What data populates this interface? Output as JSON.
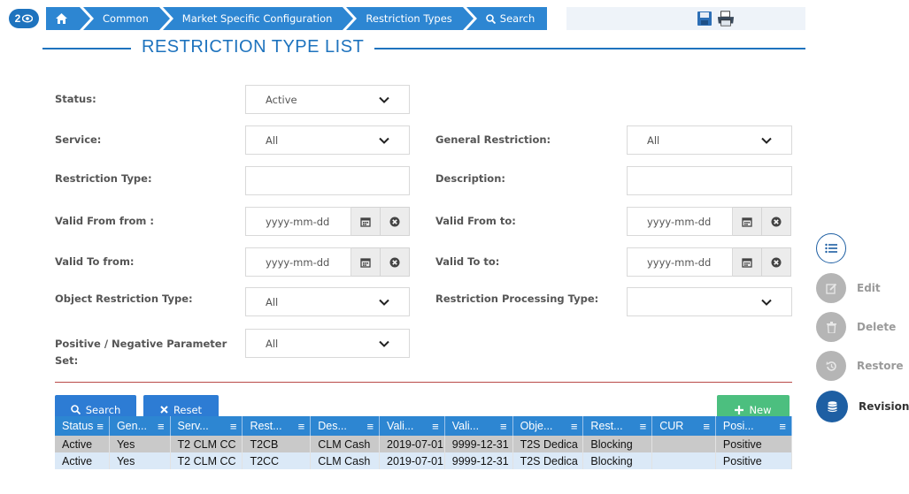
{
  "breadcrumb": {
    "badge": "2",
    "items": [
      "Common",
      "Market Specific Configuration",
      "Restriction Types",
      "Search"
    ]
  },
  "title": "RESTRICTION TYPE LIST",
  "form": {
    "status": {
      "label": "Status:",
      "value": "Active"
    },
    "service": {
      "label": "Service:",
      "value": "All"
    },
    "general_restriction": {
      "label": "General Restriction:",
      "value": "All"
    },
    "restriction_type": {
      "label": "Restriction Type:",
      "value": ""
    },
    "description": {
      "label": "Description:",
      "value": ""
    },
    "valid_from_from": {
      "label": "Valid From from :",
      "placeholder": "yyyy-mm-dd"
    },
    "valid_from_to": {
      "label": "Valid From to:",
      "placeholder": "yyyy-mm-dd"
    },
    "valid_to_from": {
      "label": "Valid To from:",
      "placeholder": "yyyy-mm-dd"
    },
    "valid_to_to": {
      "label": "Valid To to:",
      "placeholder": "yyyy-mm-dd"
    },
    "object_restriction_type": {
      "label": "Object Restriction Type:",
      "value": "All"
    },
    "restriction_processing_type": {
      "label": "Restriction Processing Type:",
      "value": ""
    },
    "pos_neg_param": {
      "label_line1": "Positive / Negative Parameter",
      "label_line2": "Set:",
      "value": "All"
    }
  },
  "buttons": {
    "search": "Search",
    "reset": "Reset",
    "new": "New"
  },
  "side_actions": {
    "edit": "Edit",
    "delete": "Delete",
    "restore": "Restore",
    "revisions": "Revisions"
  },
  "table": {
    "headers": [
      "Status",
      "Gen...",
      "Serv...",
      "Rest...",
      "Des...",
      "Vali...",
      "Vali...",
      "Obje...",
      "Rest...",
      "CUR",
      "Posi..."
    ],
    "rows": [
      [
        "Active",
        "Yes",
        "T2 CLM CC",
        "T2CB",
        "CLM Cash",
        "2019-07-01",
        "9999-12-31",
        "T2S Dedica",
        "Blocking",
        "",
        "Positive"
      ],
      [
        "Active",
        "Yes",
        "T2 CLM CC",
        "T2CC",
        "CLM Cash",
        "2019-07-01",
        "9999-12-31",
        "T2S Dedica",
        "Blocking",
        "",
        "Positive"
      ]
    ]
  },
  "colors": {
    "primary": "#2d86d2",
    "accent_green": "#4cbf7f",
    "divider_red": "#b94a48",
    "revisions_active": "#1e5fa3",
    "disabled": "#b5b5b5"
  }
}
